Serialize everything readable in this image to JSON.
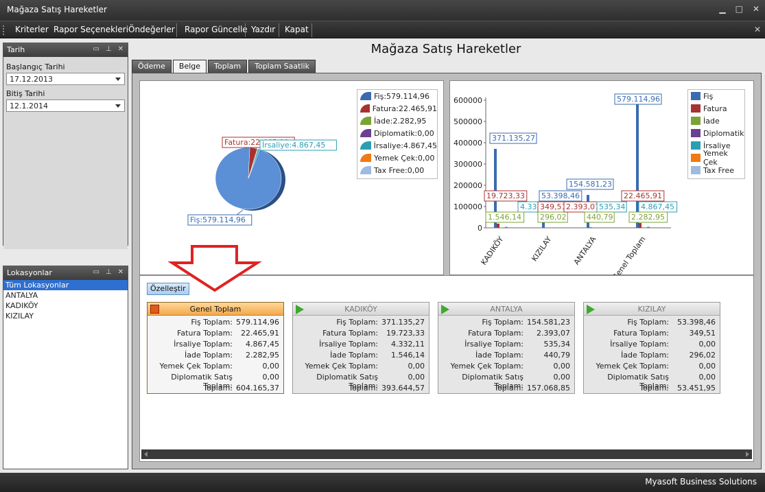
{
  "window": {
    "title": "Mağaza Satış Hareketler"
  },
  "menu": [
    {
      "label": "Kriterler"
    },
    {
      "label": "Rapor Seçenekleri"
    },
    {
      "label": "Öndeğerler"
    },
    {
      "label": "Rapor Güncelle"
    },
    {
      "label": "Yazdır"
    },
    {
      "label": "Kapat"
    }
  ],
  "tarih_panel": {
    "title": "Tarih",
    "start_label": "Başlangıç Tarihi",
    "start_value": "17.12.2013",
    "end_label": "Bitiş Tarihi",
    "end_value": "12.1.2014"
  },
  "lokasyon_panel": {
    "title": "Lokasyonlar",
    "items": [
      "Tüm Lokasyonlar",
      "ANTALYA",
      "KADIKÖY",
      "KIZILAY"
    ],
    "selected_index": 0
  },
  "report_title": "Mağaza Satış Hareketler",
  "tabs": [
    {
      "label": "Ödeme",
      "active": false
    },
    {
      "label": "Belge",
      "active": true
    },
    {
      "label": "Toplam",
      "active": false
    },
    {
      "label": "Toplam Saatlik",
      "active": false
    }
  ],
  "colors": {
    "fis": "#3a6bb0",
    "fatura": "#a83232",
    "iade": "#7aa333",
    "diplomatik": "#6b3f91",
    "irsaliye": "#2b9eb3",
    "yemek_cek": "#ef7a16",
    "tax_free": "#9dbbe0"
  },
  "chart_data": [
    {
      "type": "pie",
      "legend": [
        "Fiş:579.114,96",
        "Fatura:22.465,91",
        "İade:2.282,95",
        "Diplomatik:0,00",
        "İrsaliye:4.867,45",
        "Yemek Çek:0,00",
        "Tax Free:0,00"
      ],
      "slices": [
        {
          "name": "Fiş",
          "value": 579114.96
        },
        {
          "name": "Fatura",
          "value": 22465.91
        },
        {
          "name": "İade",
          "value": 2282.95
        },
        {
          "name": "Diplomatik",
          "value": 0
        },
        {
          "name": "İrsaliye",
          "value": 4867.45
        },
        {
          "name": "Yemek Çek",
          "value": 0
        },
        {
          "name": "Tax Free",
          "value": 0
        }
      ],
      "data_labels": {
        "fis": "Fiş:579.114,96",
        "fatura": "Fatura:22.465,91",
        "irsaliye": "İrsaliye:4.867,45"
      },
      "legend_position": "top-right"
    },
    {
      "type": "bar",
      "categories": [
        "KADIKÖY",
        "KIZILAY",
        "ANTALYA",
        "Genel Toplam"
      ],
      "ylim": [
        0,
        600000
      ],
      "yticks": [
        "0",
        "100000",
        "200000",
        "300000",
        "400000",
        "500000",
        "600000"
      ],
      "legend_position": "right",
      "series": [
        {
          "name": "Fiş",
          "values": [
            371135.27,
            53398.46,
            154581.23,
            579114.96
          ]
        },
        {
          "name": "Fatura",
          "values": [
            19723.33,
            349.51,
            2393.07,
            22465.91
          ]
        },
        {
          "name": "İade",
          "values": [
            1546.14,
            296.02,
            440.79,
            2282.95
          ]
        },
        {
          "name": "Diplomatik",
          "values": [
            0,
            0,
            0,
            0
          ]
        },
        {
          "name": "İrsaliye",
          "values": [
            4332.11,
            0,
            535.34,
            4867.45
          ]
        },
        {
          "name": "Yemek Çek",
          "values": [
            0,
            0,
            0,
            0
          ]
        },
        {
          "name": "Tax Free",
          "values": [
            0,
            0,
            0,
            0
          ]
        }
      ],
      "data_labels": [
        {
          "text": "371.135,27",
          "series": "Fiş",
          "category": "KADIKÖY"
        },
        {
          "text": "19.723,33",
          "series": "Fatura",
          "category": "KADIKÖY"
        },
        {
          "text": "4.332,11",
          "series": "İrsaliye",
          "category": "KADIKÖY"
        },
        {
          "text": "1.546,14",
          "series": "İade",
          "category": "KADIKÖY"
        },
        {
          "text": "53.398,46",
          "series": "Fiş",
          "category": "KIZILAY"
        },
        {
          "text": "349,51",
          "series": "Fatura",
          "category": "KIZILAY"
        },
        {
          "text": "296,02",
          "series": "İade",
          "category": "KIZILAY"
        },
        {
          "text": "154.581,23",
          "series": "Fiş",
          "category": "ANTALYA"
        },
        {
          "text": "2.393,07",
          "series": "Fatura",
          "category": "ANTALYA"
        },
        {
          "text": "535,34",
          "series": "İrsaliye",
          "category": "ANTALYA"
        },
        {
          "text": "440,79",
          "series": "İade",
          "category": "ANTALYA"
        },
        {
          "text": "579.114,96",
          "series": "Fiş",
          "category": "Genel Toplam"
        },
        {
          "text": "22.465,91",
          "series": "Fatura",
          "category": "Genel Toplam"
        },
        {
          "text": "4.867,45",
          "series": "İrsaliye",
          "category": "Genel Toplam"
        },
        {
          "text": "2.282,95",
          "series": "İade",
          "category": "Genel Toplam"
        }
      ]
    }
  ],
  "customize_label": "Özelleştir",
  "summary_labels": [
    "Fiş Toplam:",
    "Fatura Toplam:",
    "İrsaliye Toplam:",
    "İade Toplam:",
    "Yemek Çek Toplam:",
    "Diplomatik Satış Toplam:",
    "Toplam:"
  ],
  "cards": [
    {
      "title": "Genel Toplam",
      "active": true,
      "values": [
        "579.114,96",
        "22.465,91",
        "4.867,45",
        "2.282,95",
        "0,00",
        "0,00",
        "604.165,37"
      ]
    },
    {
      "title": "KADIKÖY",
      "active": false,
      "values": [
        "371.135,27",
        "19.723,33",
        "4.332,11",
        "1.546,14",
        "0,00",
        "0,00",
        "393.644,57"
      ]
    },
    {
      "title": "ANTALYA",
      "active": false,
      "values": [
        "154.581,23",
        "2.393,07",
        "535,34",
        "440,79",
        "0,00",
        "0,00",
        "157.068,85"
      ]
    },
    {
      "title": "KIZILAY",
      "active": false,
      "values": [
        "53.398,46",
        "349,51",
        "0,00",
        "296,02",
        "0,00",
        "0,00",
        "53.451,95"
      ]
    }
  ],
  "status": {
    "company": "Myasoft Business Solutions"
  }
}
